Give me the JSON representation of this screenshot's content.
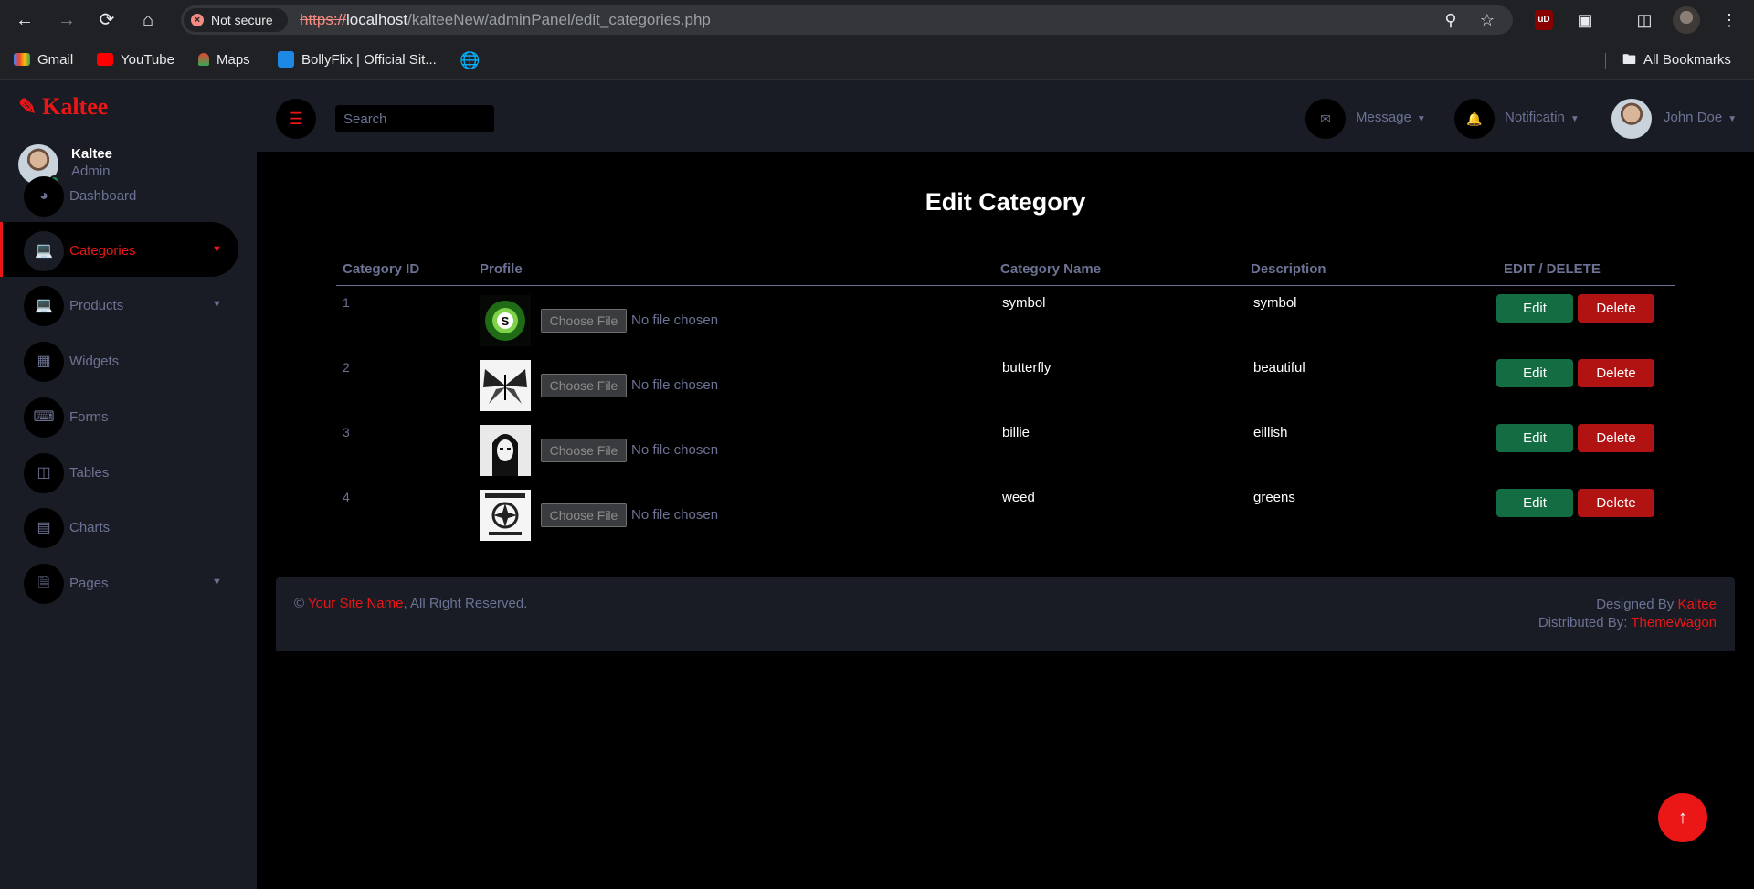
{
  "browser": {
    "security_label": "Not secure",
    "url_scheme": "https://",
    "url_host": "localhost",
    "url_path": "/kalteeNew/adminPanel/edit_categories.php",
    "bookmarks": [
      "Gmail",
      "YouTube",
      "Maps",
      "BollyFlix | Official Sit..."
    ],
    "all_bookmarks": "All Bookmarks"
  },
  "brand": {
    "name": "Kaltee"
  },
  "profile": {
    "name": "Kaltee",
    "role": "Admin"
  },
  "sidebar": {
    "items": [
      {
        "label": "Dashboard",
        "icon": "tachometer-icon",
        "active": false,
        "has_chevron": false
      },
      {
        "label": "Categories",
        "icon": "laptop-icon",
        "active": true,
        "has_chevron": true
      },
      {
        "label": "Products",
        "icon": "laptop-icon",
        "active": false,
        "has_chevron": true
      },
      {
        "label": "Widgets",
        "icon": "grid-icon",
        "active": false,
        "has_chevron": false
      },
      {
        "label": "Forms",
        "icon": "keyboard-icon",
        "active": false,
        "has_chevron": false
      },
      {
        "label": "Tables",
        "icon": "table-icon",
        "active": false,
        "has_chevron": false
      },
      {
        "label": "Charts",
        "icon": "chart-bar-icon",
        "active": false,
        "has_chevron": false
      },
      {
        "label": "Pages",
        "icon": "file-icon",
        "active": false,
        "has_chevron": true
      }
    ]
  },
  "topbar": {
    "search_placeholder": "Search",
    "message_label": "Message",
    "notification_label": "Notificatin",
    "user_name": "John Doe"
  },
  "page": {
    "title": "Edit Category",
    "headers": [
      "Category ID",
      "Profile",
      "Category Name",
      "Description",
      "EDIT / DELETE"
    ],
    "rows": [
      {
        "id": "1",
        "name": "symbol",
        "description": "symbol",
        "image": "green-s-logo"
      },
      {
        "id": "2",
        "name": "butterfly",
        "description": "beautiful",
        "image": "butterfly"
      },
      {
        "id": "3",
        "name": "billie",
        "description": "eillish",
        "image": "portrait"
      },
      {
        "id": "4",
        "name": "weed",
        "description": "greens",
        "image": "poster"
      }
    ],
    "choose_file_label": "Choose File",
    "no_file_label": "No file chosen",
    "edit_label": "Edit",
    "delete_label": "Delete"
  },
  "footer": {
    "copyright": "©",
    "site_name": "Your Site Name",
    "rights": ", All Right Reserved.",
    "designed_by": "Designed By",
    "designer": "Kaltee",
    "distributed_by": "Distributed By:",
    "distributor": "ThemeWagon"
  },
  "colors": {
    "accent": "#eb1616",
    "panel": "#191c24",
    "muted": "#6c7293",
    "edit": "#146c43",
    "delete": "#b11212"
  }
}
